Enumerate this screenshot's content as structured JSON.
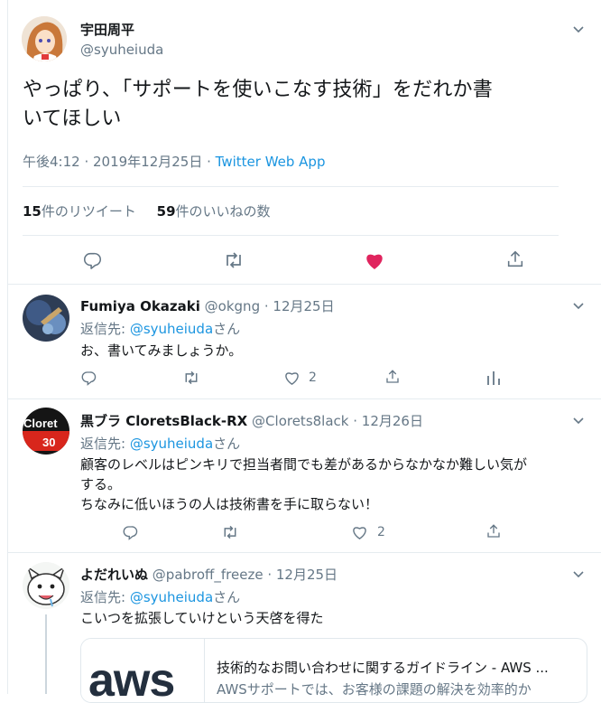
{
  "main_tweet": {
    "display_name": "宇田周平",
    "handle": "@syuheiuda",
    "text_line1": "やっぱり、「サポートを使いこなす技術」をだれか書",
    "text_line2": "いてほしい",
    "time": "午後4:12 · 2019年12月25日 · ",
    "source": "Twitter Web App",
    "retweets_count": "15",
    "retweets_label": "件のリツイート",
    "likes_count": "59",
    "likes_label": "件のいいねの数"
  },
  "replies": [
    {
      "display_name": "Fumiya Okazaki",
      "handle": "@okgng",
      "date": "· 12月25日",
      "reply_label": "返信先: ",
      "reply_to": "@syuheiuda",
      "reply_suffix": "さん",
      "text": "お、書いてみましょうか。",
      "like_count": "2"
    },
    {
      "display_name": "黒ブラ CloretsBlack-RX",
      "handle": "@Clorets8lack",
      "date": "· 12月26日",
      "reply_label": "返信先: ",
      "reply_to": "@syuheiuda",
      "reply_suffix": "さん",
      "text_line1": "顧客のレベルはピンキリで担当者間でも差があるからなかなか難しい気が",
      "text_line2": "する。",
      "text_line3": "ちなみに低いほうの人は技術書を手に取らない！",
      "like_count": "2",
      "avatar_text": "Cloret",
      "avatar_sub": "30"
    },
    {
      "display_name": "よだれいぬ",
      "handle": "@pabroff_freeze",
      "date": "· 12月25日",
      "reply_label": "返信先: ",
      "reply_to": "@syuheiuda",
      "reply_suffix": "さん",
      "text": "こいつを拡張していけという天啓を得た",
      "card_logo": "aws",
      "card_title": "技術的なお問い合わせに関するガイドライン - AWS ...",
      "card_desc": "AWSサポートでは、お客様の課題の解決を効率的か"
    }
  ],
  "colors": {
    "accent": "#1b95e0",
    "like": "#e0245e",
    "muted": "#657786",
    "border": "#e6ecf0"
  }
}
